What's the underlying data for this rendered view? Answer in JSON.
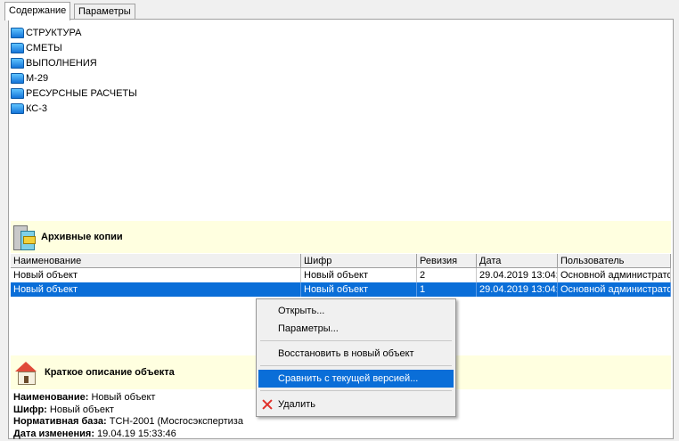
{
  "tabs": [
    {
      "label": "Содержание"
    },
    {
      "label": "Параметры"
    }
  ],
  "tree": {
    "items": [
      {
        "label": "СТРУКТУРА",
        "icon": "folder-icon"
      },
      {
        "label": "СМЕТЫ",
        "icon": "folder-icon"
      },
      {
        "label": "ВЫПОЛНЕНИЯ",
        "icon": "folder-icon"
      },
      {
        "label": "М-29",
        "icon": "folder-icon"
      },
      {
        "label": "РЕСУРСНЫЕ РАСЧЕТЫ",
        "icon": "folder-icon"
      },
      {
        "label": "КС-3",
        "icon": "folder-icon"
      }
    ]
  },
  "archive": {
    "title": "Архивные копии",
    "columns": [
      "Наименование",
      "Шифр",
      "Ревизия",
      "Дата",
      "Пользователь"
    ],
    "rows": [
      {
        "name": "Новый объект",
        "code": "Новый объект",
        "revision": "2",
        "date": "29.04.2019 13:04:",
        "user": "Основной администратор"
      },
      {
        "name": "Новый объект",
        "code": "Новый объект",
        "revision": "1",
        "date": "29.04.2019 13:04:",
        "user": "Основной администратор"
      }
    ],
    "selected_row": 1
  },
  "description": {
    "title": "Краткое описание объекта",
    "fields": [
      {
        "label": "Наименование:",
        "value": "Новый объект"
      },
      {
        "label": "Шифр:",
        "value": "Новый объект"
      },
      {
        "label": "Нормативная база:",
        "value": "ТСН-2001 (Мосгосэкспертиза"
      },
      {
        "label": "Дата изменения:",
        "value": "19.04.19 15:33:46"
      }
    ]
  },
  "context_menu": {
    "items": [
      {
        "label": "Открыть..."
      },
      {
        "label": "Параметры..."
      },
      {
        "label": "Восстановить в новый объект"
      },
      {
        "label": "Сравнить с текущей версией..."
      },
      {
        "label": "Удалить",
        "icon": "delete-x-icon"
      }
    ],
    "highlighted": 3
  },
  "colors": {
    "selection": "#0a6ed8",
    "section_bg": "#ffffe0",
    "folder": "#2a9bf0",
    "delete": "#e0302a"
  }
}
